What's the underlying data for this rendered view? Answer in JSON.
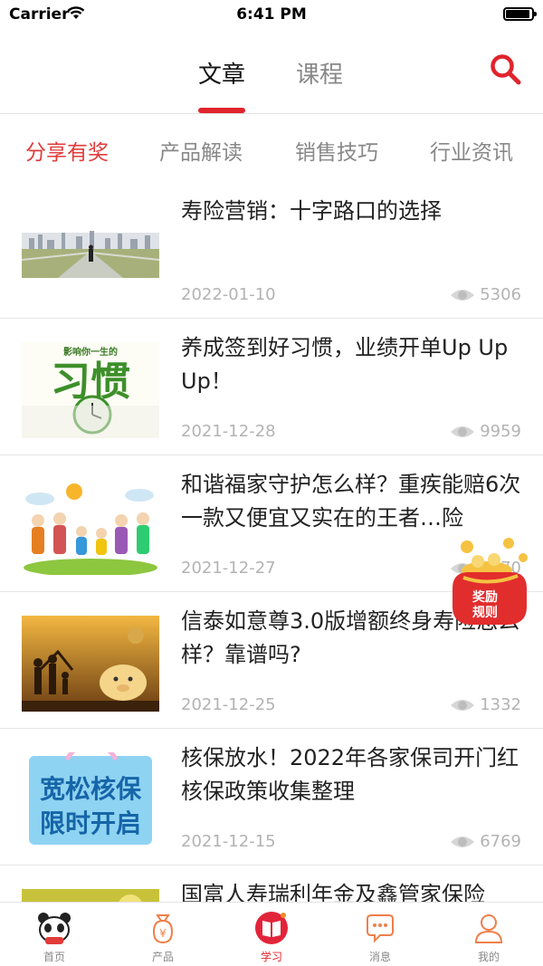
{
  "status_bar": {
    "carrier": "Carrier",
    "time": "6:41 PM"
  },
  "header": {
    "tabs": [
      {
        "label": "文章",
        "active": true
      },
      {
        "label": "课程",
        "active": false
      }
    ],
    "search_icon": "search-icon",
    "accent_color": "#e0242d"
  },
  "categories": [
    {
      "label": "分享有奖",
      "active": true
    },
    {
      "label": "产品解读",
      "active": false
    },
    {
      "label": "销售技巧",
      "active": false
    },
    {
      "label": "行业资讯",
      "active": false
    }
  ],
  "articles": [
    {
      "title": "寿险营销：十字路口的选择",
      "date": "2022-01-10",
      "views": "5306"
    },
    {
      "title": "养成签到好习惯，业绩开单Up Up Up！",
      "date": "2021-12-28",
      "views": "9959",
      "thumb_text": "影响你一生的",
      "thumb_big": "习惯"
    },
    {
      "title": "和谐福家守护怎么样？重疾能赔6次 一款又便宜又实在的王者…险",
      "date": "2021-12-27",
      "views": "6770"
    },
    {
      "title": "信泰如意尊3.0版增额终身寿险怎么样？靠谱吗?",
      "date": "2021-12-25",
      "views": "1332"
    },
    {
      "title": "核保放水！2022年各家保司开门红核保政策收集整理",
      "date": "2021-12-15",
      "views": "6769",
      "thumb_text_1": "宽松核保",
      "thumb_text_2": "限时开启"
    },
    {
      "title": "国富人寿瑞利年金及鑫管家保险",
      "date": "",
      "views": ""
    }
  ],
  "reward": {
    "label_line1": "奖励",
    "label_line2": "规则"
  },
  "tab_bar": [
    {
      "label": "首页",
      "icon": "panda-icon",
      "active": false
    },
    {
      "label": "产品",
      "icon": "money-bag-icon",
      "active": false
    },
    {
      "label": "学习",
      "icon": "book-icon",
      "active": true
    },
    {
      "label": "消息",
      "icon": "message-icon",
      "active": false
    },
    {
      "label": "我的",
      "icon": "person-icon",
      "active": false
    }
  ]
}
